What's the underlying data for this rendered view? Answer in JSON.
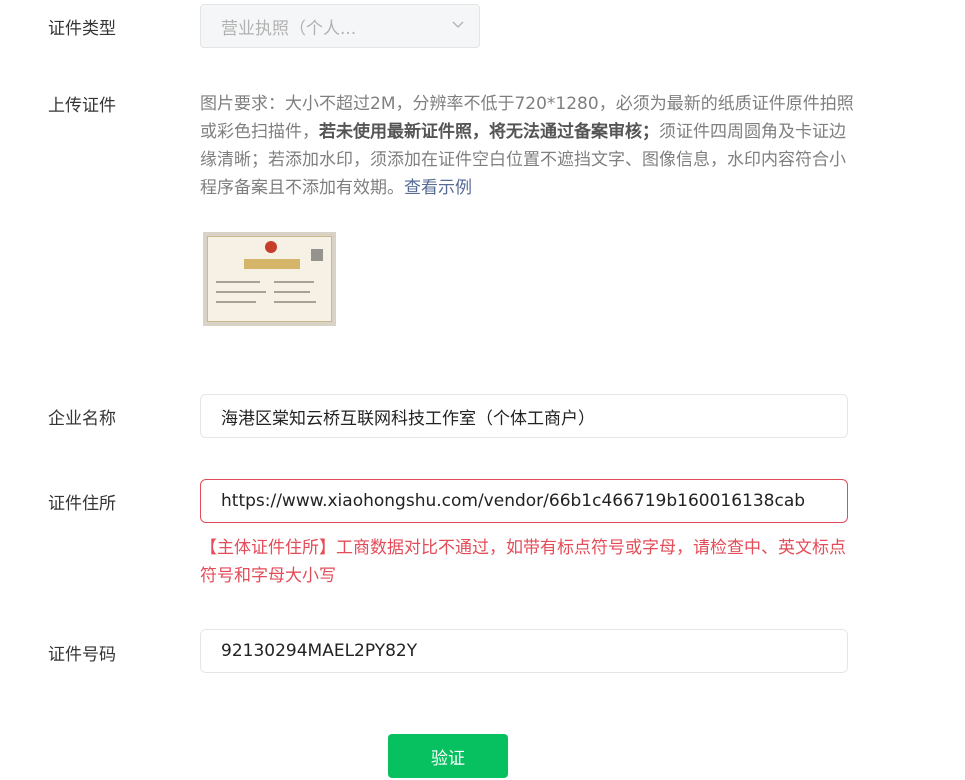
{
  "form": {
    "cert_type": {
      "label": "证件类型",
      "value": "营业执照（个人..."
    },
    "upload": {
      "label": "上传证件",
      "desc_part1": "图片要求：大小不超过2M，分辨率不低于720*1280，必须为最新的纸质证件原件拍照或彩色扫描件，",
      "desc_bold": "若未使用最新证件照，将无法通过备案审核；",
      "desc_part2": "须证件四周圆角及卡证边缘清晰；若添加水印，须添加在证件空白位置不遮挡文字、图像信息，水印内容符合小程序备案且不添加有效期。",
      "example_link": "查看示例"
    },
    "company_name": {
      "label": "企业名称",
      "value": "海港区棠知云桥互联网科技工作室（个体工商户）"
    },
    "cert_address": {
      "label": "证件住所",
      "value": "https://www.xiaohongshu.com/vendor/66b1c466719b160016138cab",
      "error": "【主体证件住所】工商数据对比不通过，如带有标点符号或字母，请检查中、英文标点符号和字母大小写"
    },
    "cert_number": {
      "label": "证件号码",
      "value": "92130294MAEL2PY82Y"
    },
    "submit_label": "验证"
  },
  "colors": {
    "primary": "#07c160",
    "error": "#e34d59",
    "link": "#576b95"
  }
}
